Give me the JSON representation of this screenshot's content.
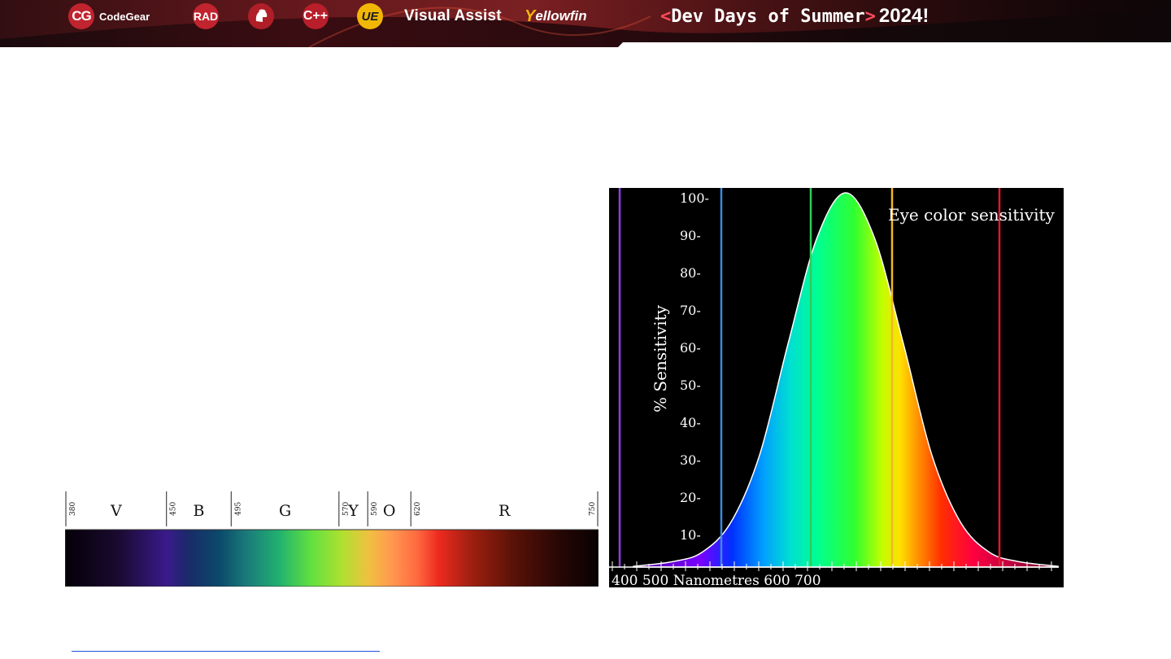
{
  "banner": {
    "logos": {
      "codegear_badge": "CG",
      "codegear": "CodeGear",
      "rad": "RAD",
      "cpp": "C++",
      "ue": "UE",
      "visual_assist": "Visual Assist",
      "yellowfin_y": "Y",
      "yellowfin_rest": "ellowfin"
    },
    "event": {
      "open": "<",
      "name": "Dev Days of Summer",
      "close": ">",
      "year": "2024!"
    },
    "colors": {
      "accent": "#c0242e",
      "bracket": "#ff4b5a",
      "ue_yellow": "#f2b705"
    }
  },
  "spectrum": {
    "bands": [
      {
        "label": "V",
        "start": "380",
        "end": "450"
      },
      {
        "label": "B",
        "start": "450",
        "end": "495"
      },
      {
        "label": "G",
        "start": "495",
        "end": "570"
      },
      {
        "label": "Y",
        "start": "570",
        "end": "590"
      },
      {
        "label": "O",
        "start": "590",
        "end": "620"
      },
      {
        "label": "R",
        "start": "620",
        "end": "750"
      }
    ],
    "tick_labels": [
      "380",
      "450",
      "495",
      "570",
      "590",
      "620",
      "750"
    ]
  },
  "chart_data": {
    "type": "area",
    "title": "Eye color sensitivity",
    "ylabel": "% Sensitivity",
    "xlabel": "Nanometres",
    "x_tick_labels": [
      "400",
      "500",
      "600",
      "700"
    ],
    "y_tick_labels": [
      "100-",
      "90-",
      "80-",
      "70-",
      "60-",
      "50-",
      "40-",
      "30-",
      "20-",
      "10-"
    ],
    "ylim": [
      0,
      100
    ],
    "x": [
      400,
      425,
      450,
      475,
      500,
      525,
      550,
      575,
      600,
      625,
      650,
      675,
      700
    ],
    "values": [
      1.5,
      4,
      12,
      30,
      60,
      88,
      100,
      88,
      60,
      30,
      12,
      4,
      1.5
    ],
    "marker_lines": [
      {
        "color": "#8e3fe6"
      },
      {
        "color": "#3a8ae0"
      },
      {
        "color": "#2fcc58"
      },
      {
        "color": "#f2b820"
      },
      {
        "color": "#e0182e"
      }
    ],
    "grid": false
  },
  "link": {
    "text": ""
  }
}
